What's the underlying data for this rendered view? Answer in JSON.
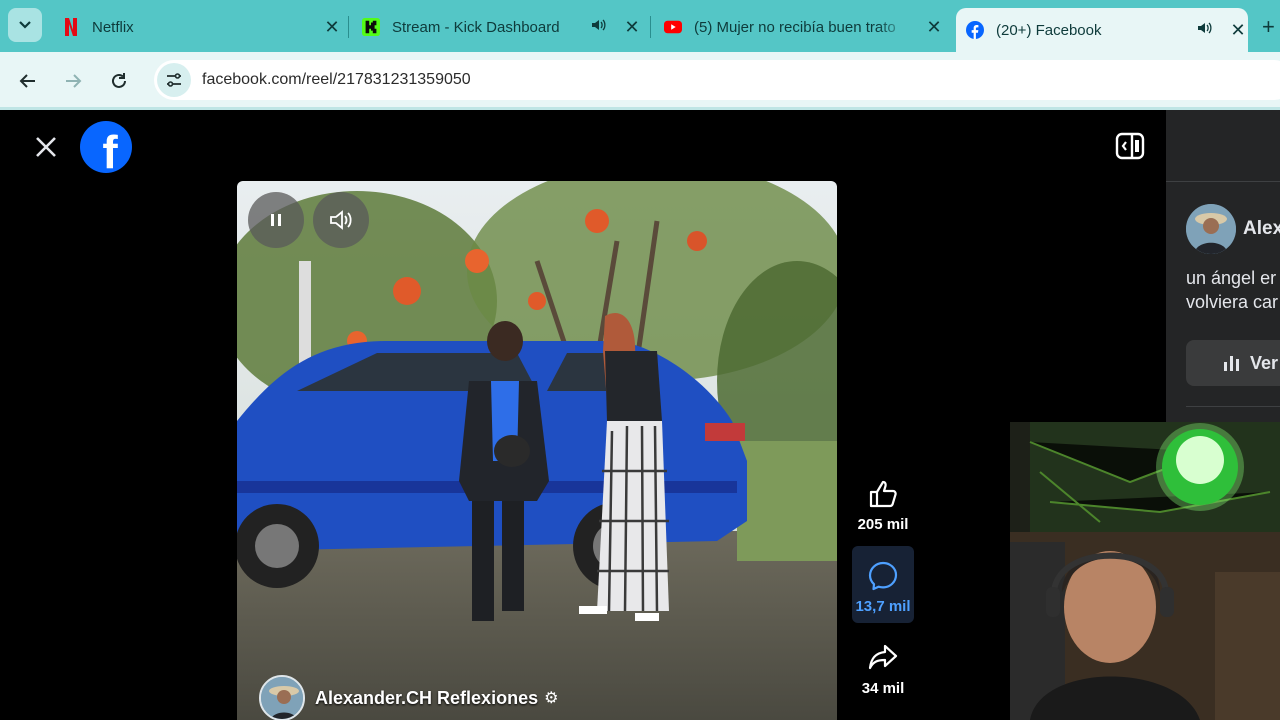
{
  "browser": {
    "tabs": [
      {
        "title": "Netflix",
        "favicon": "netflix-icon",
        "audio": false,
        "active": false
      },
      {
        "title": "Stream - Kick Dashboard",
        "favicon": "kick-icon",
        "audio": true,
        "active": false
      },
      {
        "title": "(5) Mujer no recibía buen trato",
        "favicon": "youtube-icon",
        "audio": false,
        "active": false
      },
      {
        "title": "(20+) Facebook",
        "favicon": "facebook-icon",
        "audio": true,
        "active": true
      }
    ],
    "url": "facebook.com/reel/217831231359050",
    "colors": {
      "tabbar": "#54c6c6",
      "toolbar": "#e8f6f6"
    }
  },
  "page": {
    "logo_letter": "f",
    "reel": {
      "author_name": "Alexander.CH Reflexiones",
      "likes": "205 mil",
      "comments": "13,7 mil",
      "shares": "34 mil"
    },
    "side_panel": {
      "author_name": "Alex",
      "caption_line1": "un ángel er",
      "caption_line2": "volviera car",
      "insights_label": "Ver"
    }
  },
  "colors": {
    "facebook_blue": "#0866ff",
    "comment_highlight": "#4ea0ff"
  }
}
